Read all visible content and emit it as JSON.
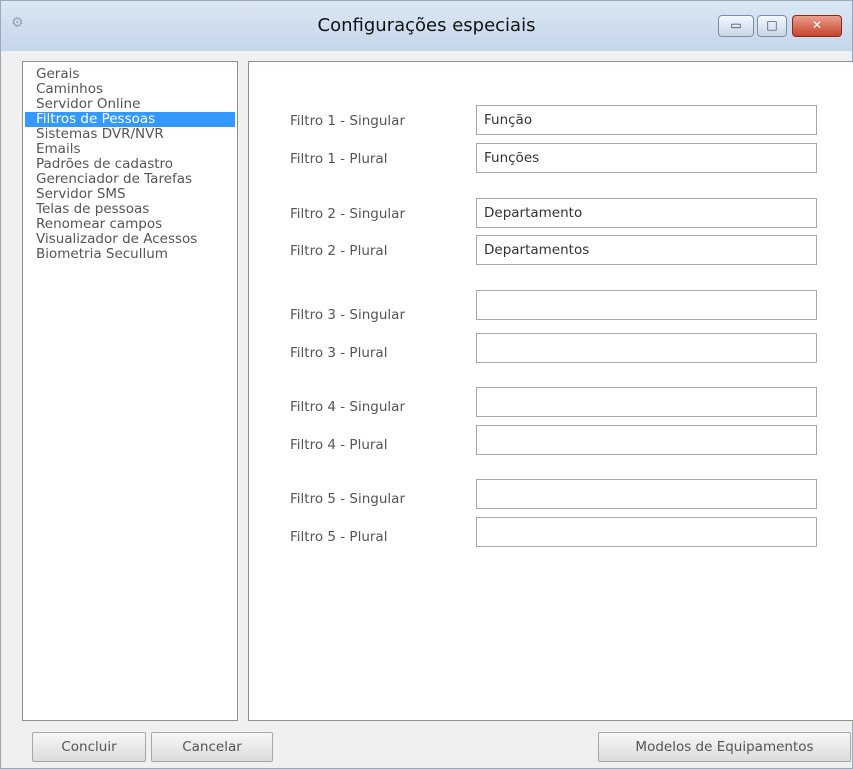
{
  "window": {
    "title": "Configurações especiais",
    "controls": {
      "minimize": "▭",
      "maximize": "□",
      "close": "✕"
    }
  },
  "nav": {
    "items": [
      {
        "label": "Gerais",
        "active": false
      },
      {
        "label": "Caminhos",
        "active": false
      },
      {
        "label": "Servidor Online",
        "active": false
      },
      {
        "label": "Filtros de Pessoas",
        "active": true
      },
      {
        "label": "Sistemas DVR/NVR",
        "active": false
      },
      {
        "label": "Emails",
        "active": false
      },
      {
        "label": "Padrões de cadastro",
        "active": false
      },
      {
        "label": "Gerenciador de Tarefas",
        "active": false
      },
      {
        "label": "Servidor SMS",
        "active": false
      },
      {
        "label": "Telas de pessoas",
        "active": false
      },
      {
        "label": "Renomear campos",
        "active": false
      },
      {
        "label": "Visualizador de Acessos",
        "active": false
      },
      {
        "label": "Biometria Secullum",
        "active": false
      }
    ]
  },
  "filters": [
    {
      "label": "Filtro 1 - Singular",
      "value": "Função"
    },
    {
      "label": "Filtro 1 - Plural",
      "value": "Funções"
    },
    {
      "label": "Filtro 2 - Singular",
      "value": "Departamento"
    },
    {
      "label": "Filtro 2 - Plural",
      "value": "Departamentos"
    },
    {
      "label": "Filtro 3 - Singular",
      "value": ""
    },
    {
      "label": "Filtro 3 - Plural",
      "value": ""
    },
    {
      "label": "Filtro 4 - Singular",
      "value": ""
    },
    {
      "label": "Filtro 4 - Plural",
      "value": ""
    },
    {
      "label": "Filtro 5 - Singular",
      "value": ""
    },
    {
      "label": "Filtro 5 - Plural",
      "value": ""
    }
  ],
  "buttons": {
    "concluir": "Concluir",
    "cancelar": "Cancelar",
    "modelos": "Modelos de Equipamentos"
  }
}
